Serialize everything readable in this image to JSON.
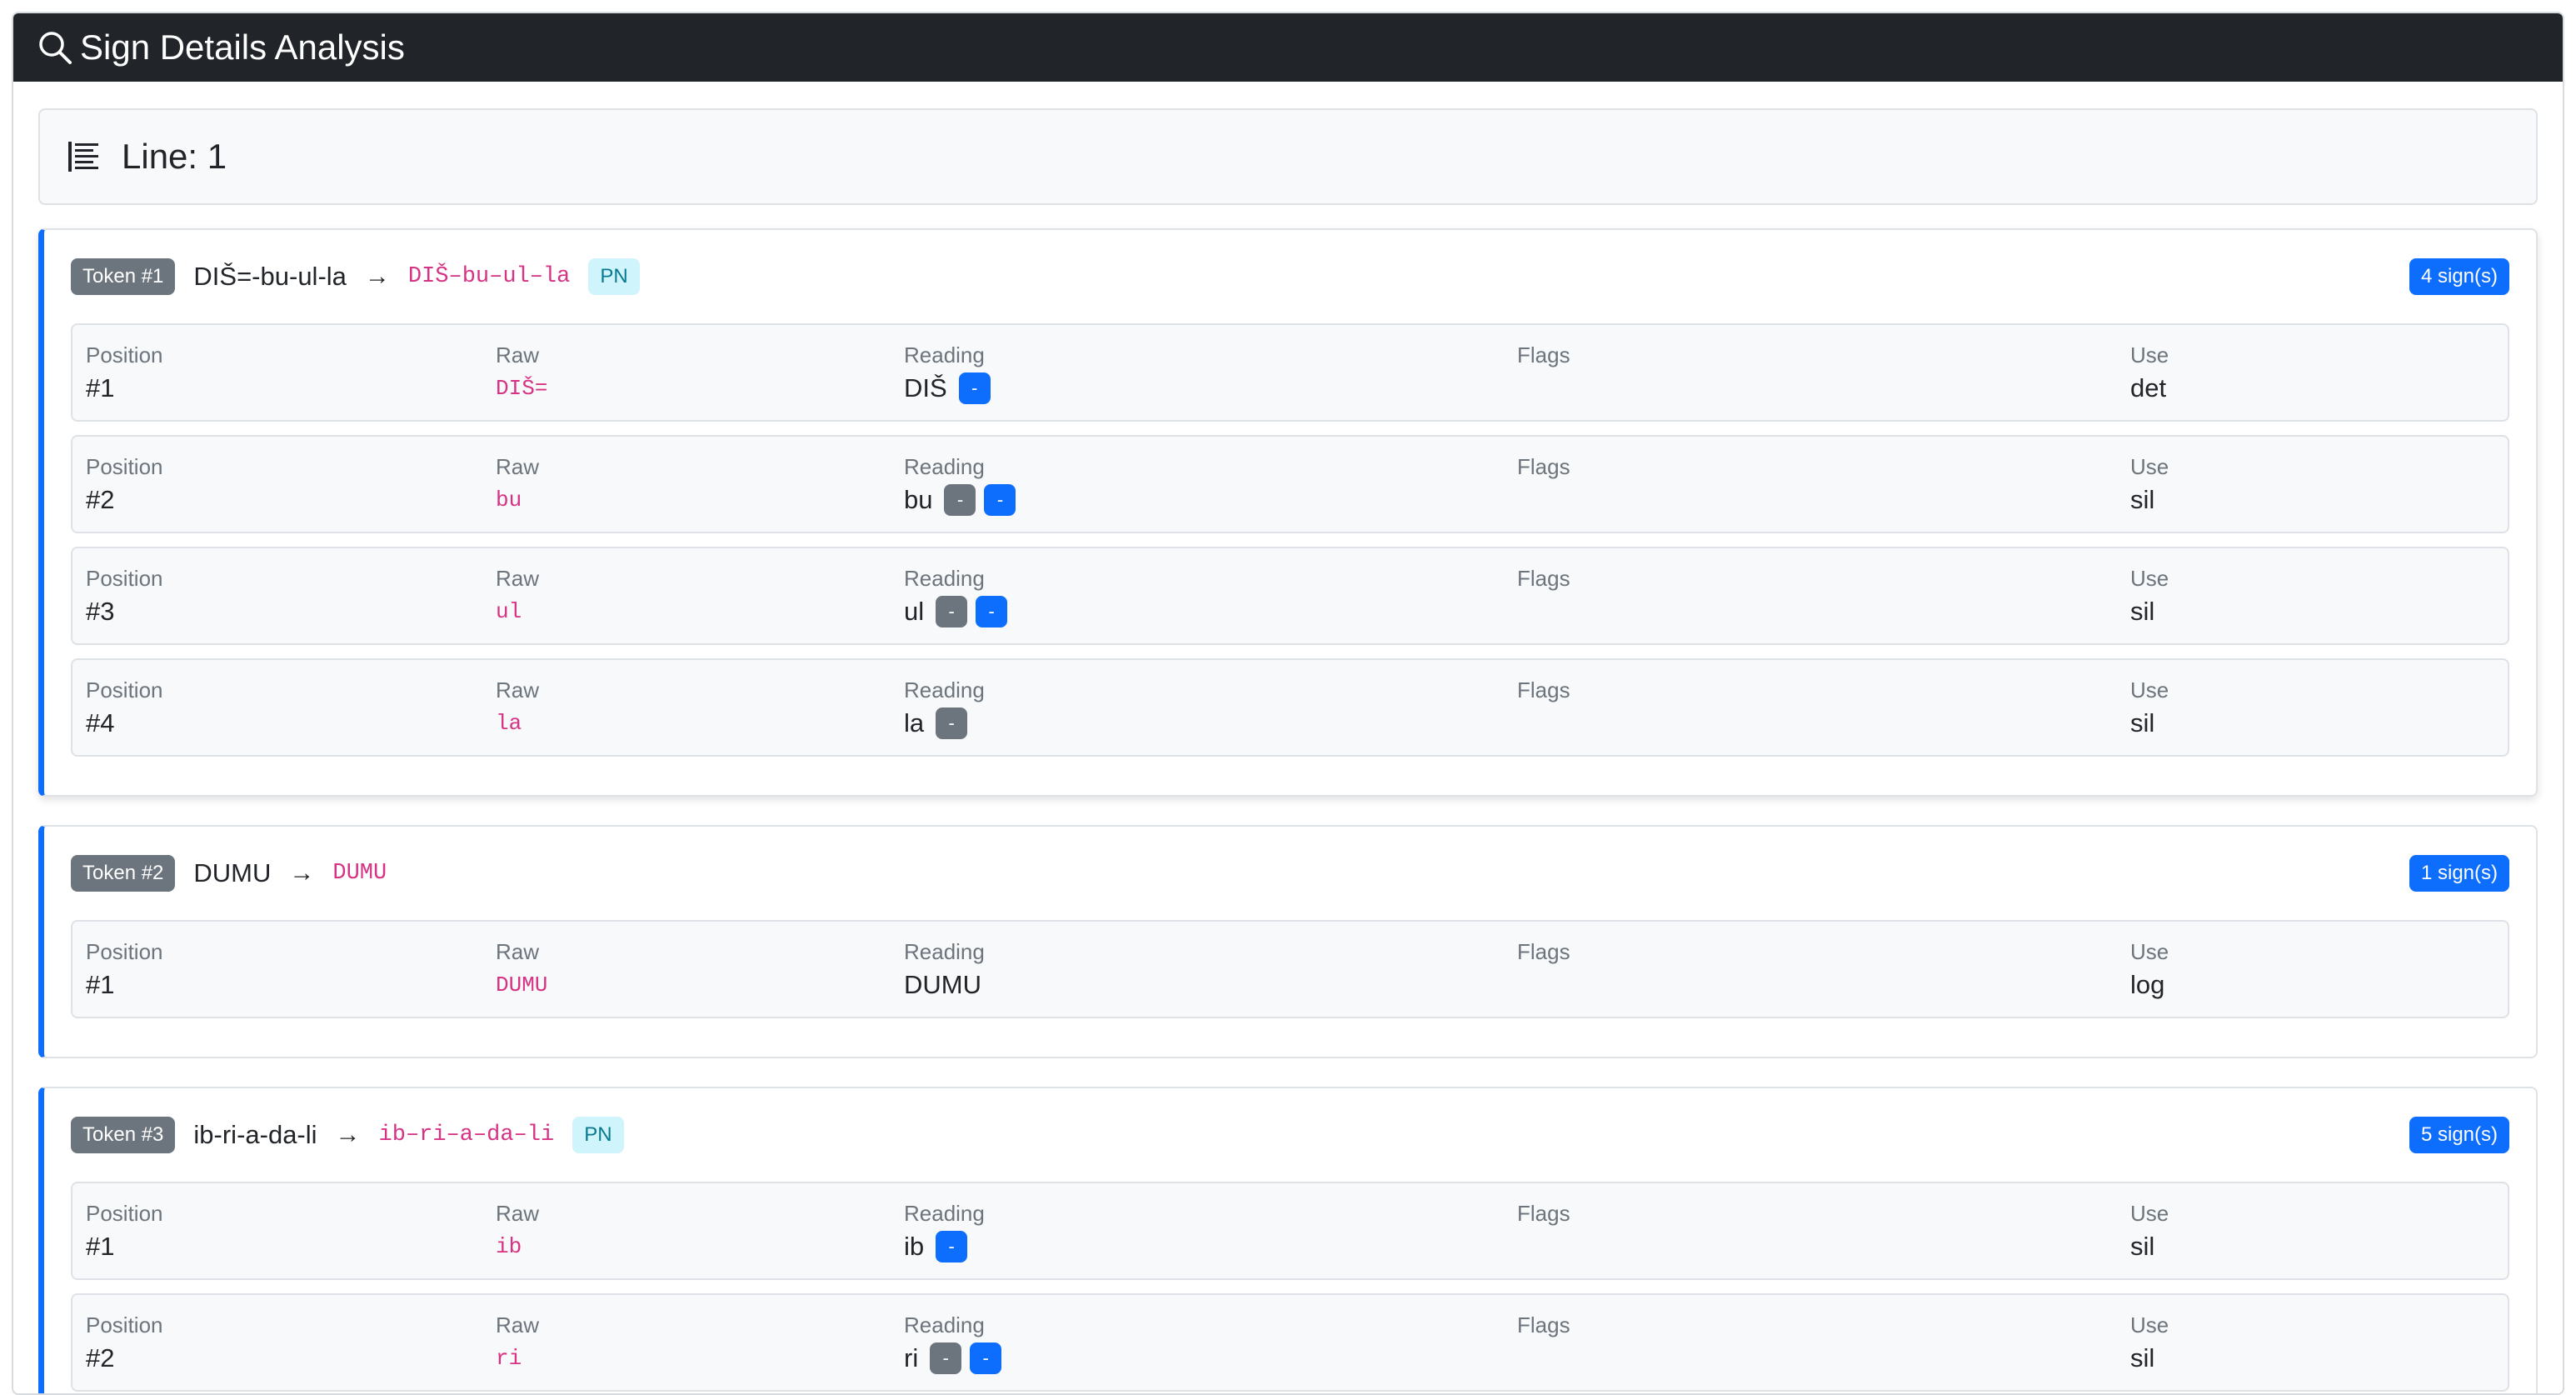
{
  "header": {
    "title": "Sign Details Analysis"
  },
  "line": {
    "label": "Line: 1"
  },
  "columns": {
    "position": "Position",
    "raw": "Raw",
    "reading": "Reading",
    "flags": "Flags",
    "use": "Use"
  },
  "tokens": [
    {
      "badge": "Token #1",
      "raw": "DIŠ=-bu-ul-la",
      "arrow": "→",
      "normalized": "DIŠ–bu–ul–la",
      "pn": "PN",
      "count": "4 sign(s)",
      "signs": [
        {
          "position": "#1",
          "raw": "DIŠ=",
          "reading": "DIŠ",
          "grey": "",
          "blue": "-",
          "flags": "",
          "use": "det"
        },
        {
          "position": "#2",
          "raw": "bu",
          "reading": "bu",
          "grey": "-",
          "blue": "-",
          "flags": "",
          "use": "sil"
        },
        {
          "position": "#3",
          "raw": "ul",
          "reading": "ul",
          "grey": "-",
          "blue": "-",
          "flags": "",
          "use": "sil"
        },
        {
          "position": "#4",
          "raw": "la",
          "reading": "la",
          "grey": "-",
          "blue": "",
          "flags": "",
          "use": "sil"
        }
      ]
    },
    {
      "badge": "Token #2",
      "raw": "DUMU",
      "arrow": "→",
      "normalized": "DUMU",
      "pn": "",
      "count": "1 sign(s)",
      "signs": [
        {
          "position": "#1",
          "raw": "DUMU",
          "reading": "DUMU",
          "grey": "",
          "blue": "",
          "flags": "",
          "use": "log"
        }
      ]
    },
    {
      "badge": "Token #3",
      "raw": "ib-ri-a-da-li",
      "arrow": "→",
      "normalized": "ib–ri–a–da–li",
      "pn": "PN",
      "count": "5 sign(s)",
      "signs": [
        {
          "position": "#1",
          "raw": "ib",
          "reading": "ib",
          "grey": "",
          "blue": "-",
          "flags": "",
          "use": "sil"
        },
        {
          "position": "#2",
          "raw": "ri",
          "reading": "ri",
          "grey": "-",
          "blue": "-",
          "flags": "",
          "use": "sil"
        }
      ]
    }
  ],
  "colors": {
    "header_bg": "#212529",
    "accent": "#0d6efd",
    "secondary": "#6c757d",
    "code": "#d63384",
    "pn_bg": "#cff4fc"
  },
  "icons": {
    "header": "search-icon",
    "line": "list-icon"
  }
}
